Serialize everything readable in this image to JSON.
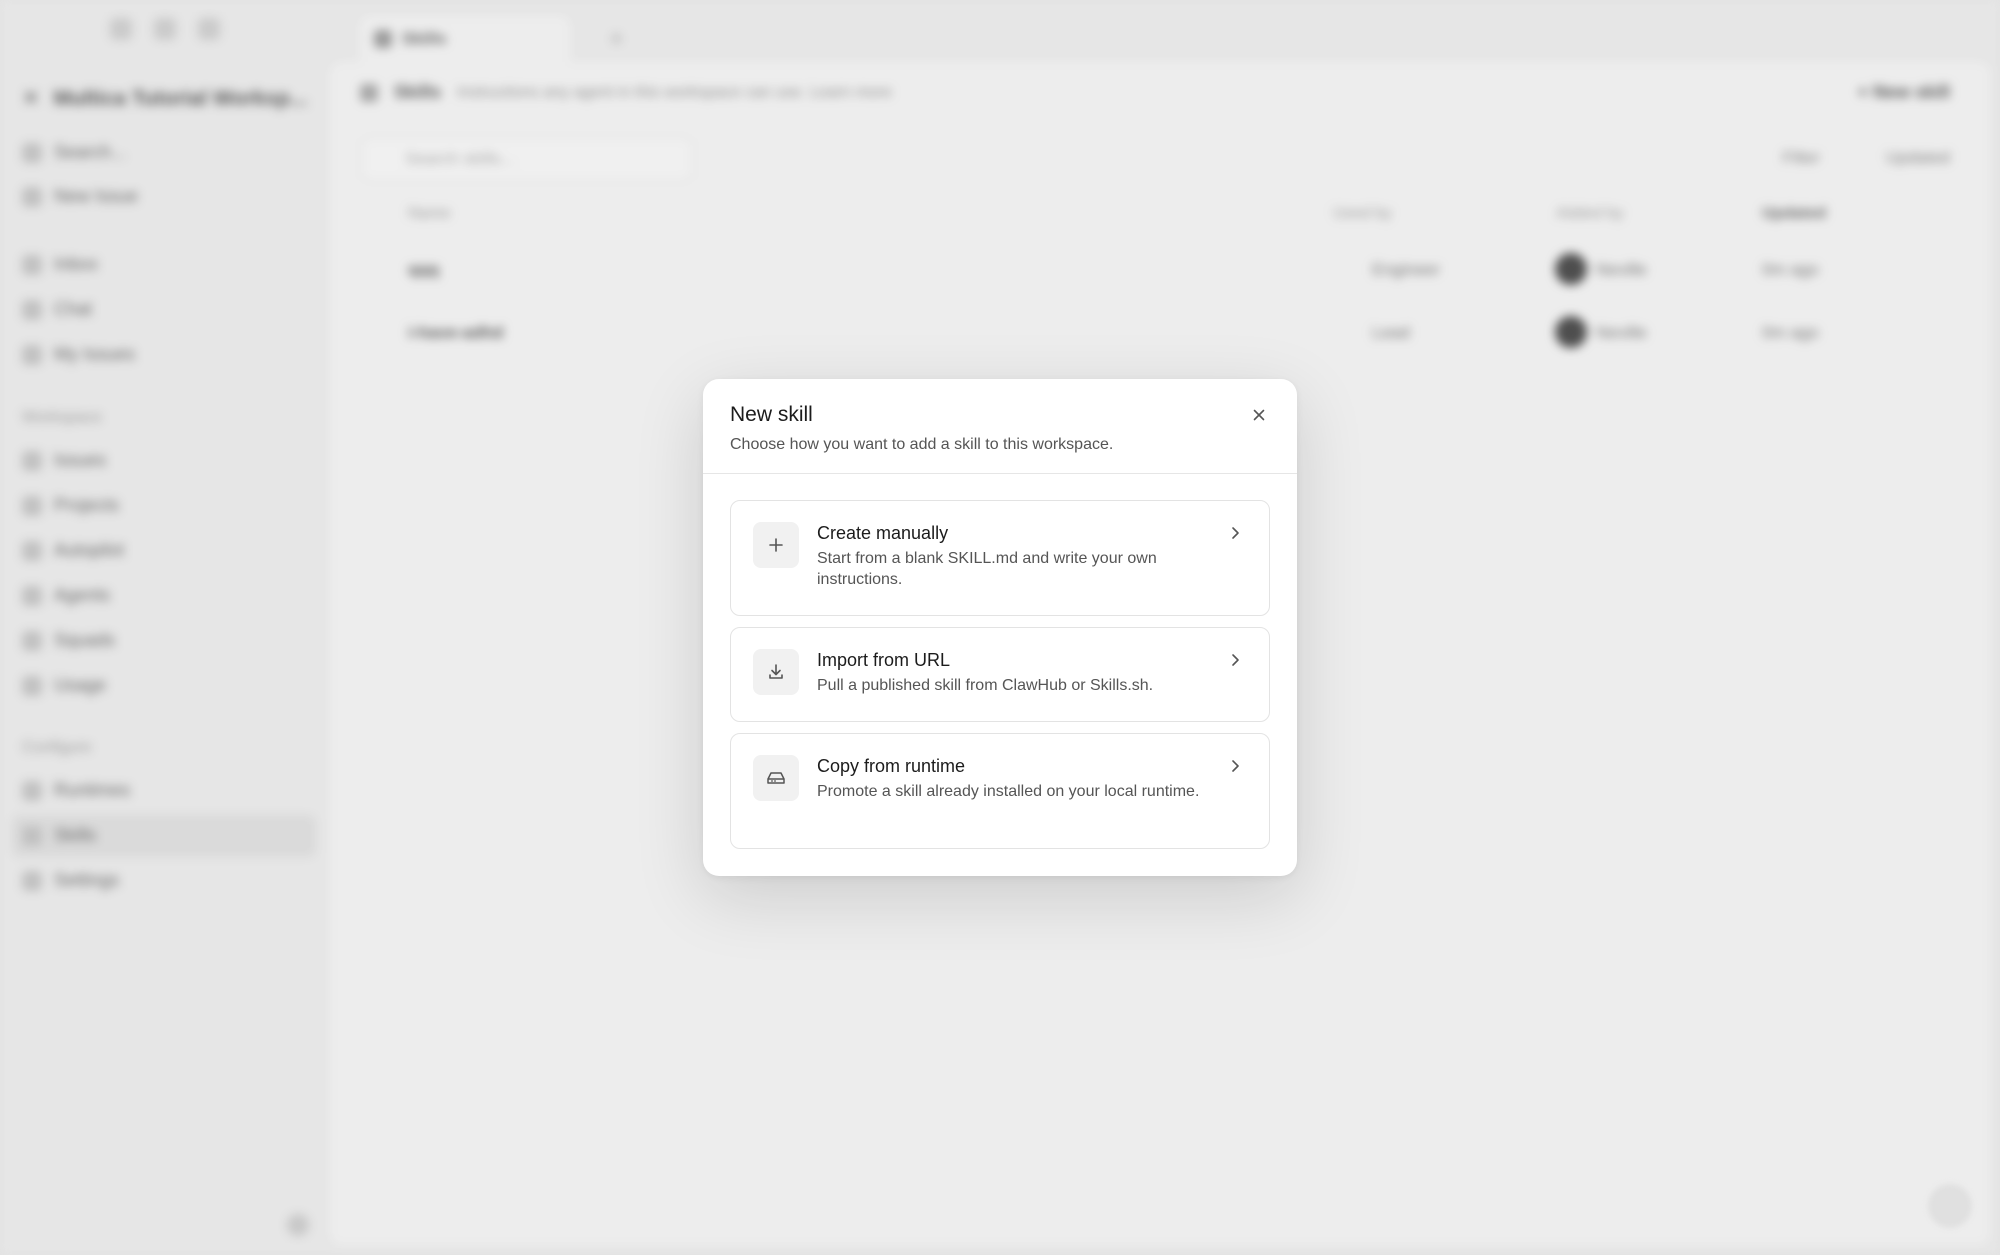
{
  "background": {
    "workspace_name": "Multica Tutorial Worksp...",
    "sidebar": {
      "search": "Search...",
      "new_issue": "New Issue",
      "items_top": [
        "Inbox",
        "Chat",
        "My Issues"
      ],
      "section_workspace": "Workspace",
      "items_workspace": [
        "Issues",
        "Projects",
        "Autopilot",
        "Agents",
        "Squads",
        "Usage"
      ],
      "section_configure": "Configure",
      "items_configure": [
        "Runtimes",
        "Skills",
        "Settings"
      ]
    },
    "tab_label": "Skills",
    "tab_add": "+",
    "header_title": "Skills",
    "header_desc": "Instructions any agent in this workspace can use. Learn more",
    "new_skill": "+ New skill",
    "search_placeholder": "Search skills...",
    "filter": "Filter",
    "updated": "Updated",
    "columns": [
      "Name",
      "Used by",
      "Added by",
      "Updated"
    ],
    "rows": [
      {
        "name": "qqq",
        "used_by": "Engineer",
        "added_by": "Neville",
        "updated": "0m ago"
      },
      {
        "name": "i-have-adhd",
        "used_by": "Lead",
        "added_by": "Neville",
        "updated": "0m ago"
      }
    ]
  },
  "modal": {
    "title": "New skill",
    "subtitle": "Choose how you want to add a skill to this workspace.",
    "options": [
      {
        "title": "Create manually",
        "description": "Start from a blank SKILL.md and write your own instructions.",
        "icon": "plus-icon"
      },
      {
        "title": "Import from URL",
        "description": "Pull a published skill from ClawHub or Skills.sh.",
        "icon": "download-icon"
      },
      {
        "title": "Copy from runtime",
        "description": "Promote a skill already installed on your local runtime.",
        "icon": "drive-icon"
      }
    ]
  }
}
